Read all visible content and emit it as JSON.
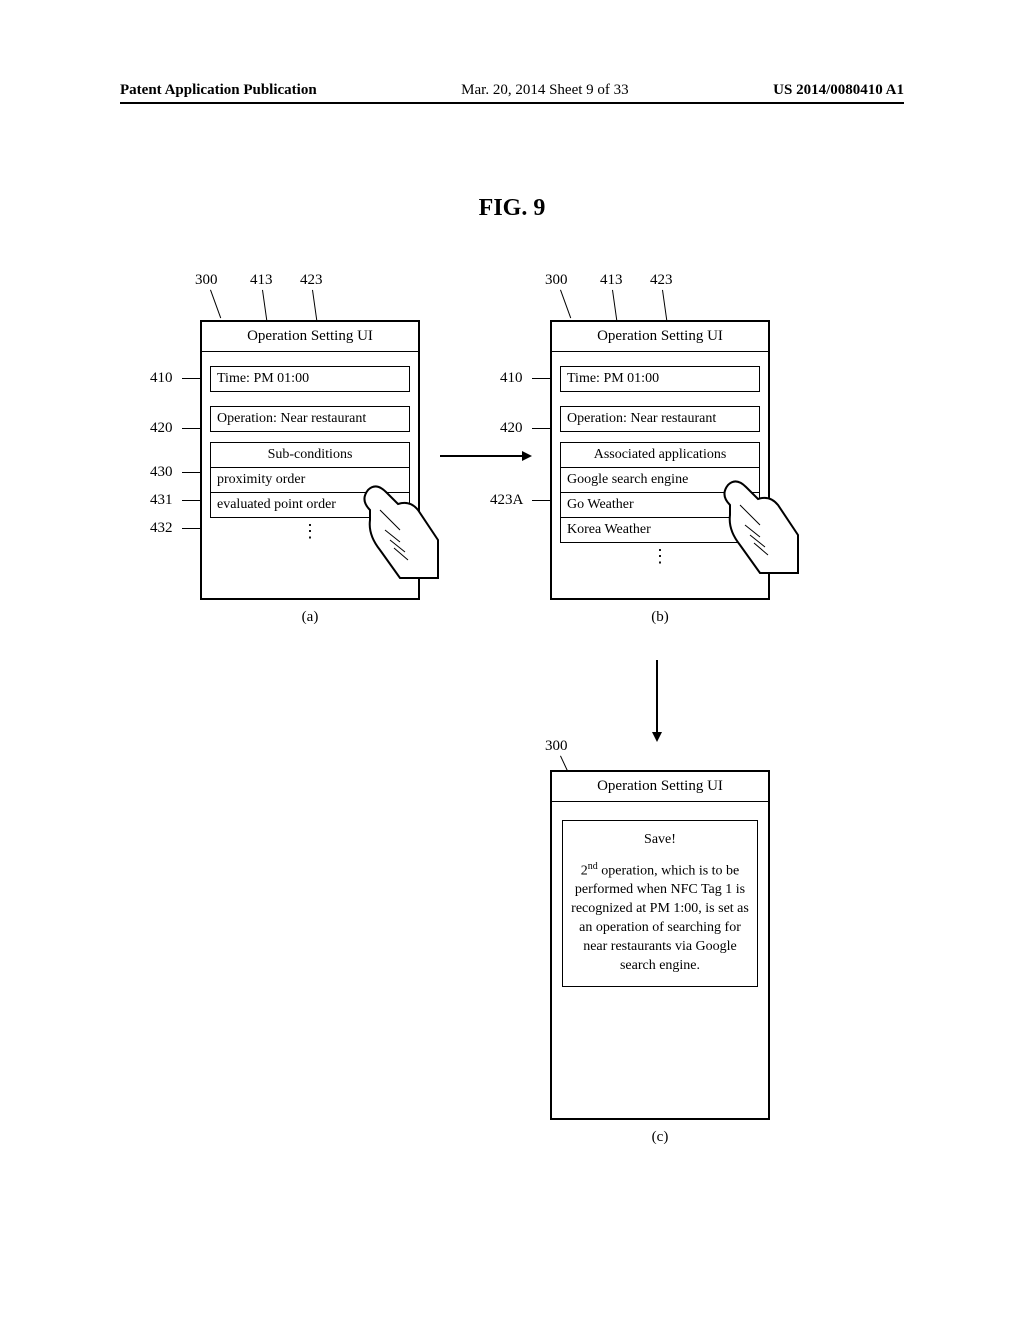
{
  "header": {
    "left": "Patent Application Publication",
    "center": "Mar. 20, 2014  Sheet 9 of 33",
    "right": "US 2014/0080410 A1"
  },
  "figure_title": "FIG.  9",
  "refs": {
    "device": "300",
    "r413": "413",
    "r423": "423",
    "r410": "410",
    "r420": "420",
    "r430": "430",
    "r431": "431",
    "r432": "432",
    "r423A": "423A"
  },
  "panel_a": {
    "screen_title": "Operation Setting UI",
    "time_row": "Time: PM 01:00",
    "operation_row": "Operation: Near restaurant",
    "subcond_header": "Sub-conditions",
    "sub1": "proximity order",
    "sub2": "evaluated point order",
    "label": "(a)"
  },
  "panel_b": {
    "screen_title": "Operation Setting UI",
    "time_row": "Time: PM 01:00",
    "operation_row": "Operation: Near restaurant",
    "assoc_header": "Associated applications",
    "app1": "Google search engine",
    "app2": "Go Weather",
    "app3": "Korea Weather",
    "label": "(b)"
  },
  "panel_c": {
    "screen_title": "Operation Setting UI",
    "save_head": "Save!",
    "save_body_pre": "2",
    "save_body_sup": "nd",
    "save_body_rest": " operation, which is to be performed when NFC Tag 1 is recognized at PM 1:00, is set as an operation of searching for near restaurants via Google search engine.",
    "label": "(c)"
  }
}
